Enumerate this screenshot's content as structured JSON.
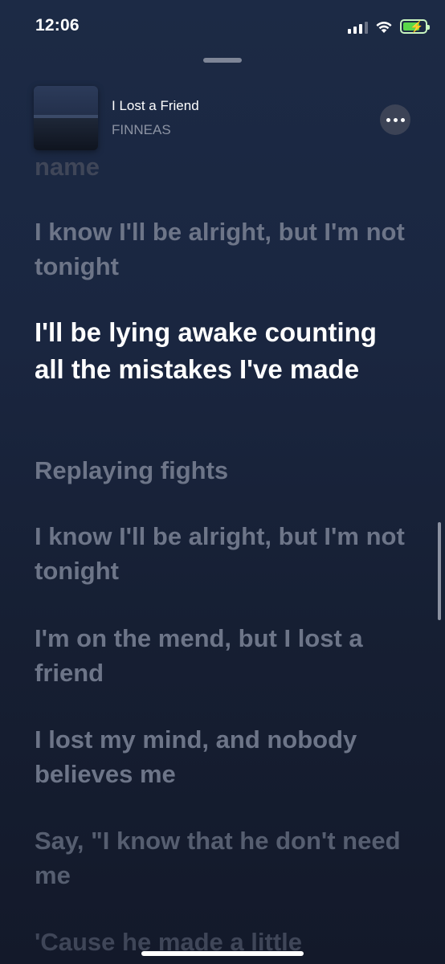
{
  "status_bar": {
    "time": "12:06",
    "signal_bars": 4,
    "signal_active": 3,
    "battery_percent": 65,
    "battery_charging": true
  },
  "now_playing": {
    "title": "I Lost a Friend",
    "artist": "FINNEAS",
    "artwork_icon": "album-art"
  },
  "lyrics": [
    {
      "text": "name",
      "state": "faded"
    },
    {
      "text": "I know I'll be alright, but I'm not tonight",
      "state": "inactive"
    },
    {
      "text": "I'll be lying awake counting all the mistakes I've made",
      "state": "active"
    },
    {
      "text": "Replaying fights",
      "state": "inactive"
    },
    {
      "text": "I know I'll be alright, but I'm not tonight",
      "state": "inactive"
    },
    {
      "text": "I'm on the mend, but I lost a friend",
      "state": "inactive"
    },
    {
      "text": "I lost my mind, and nobody believes me",
      "state": "inactive"
    },
    {
      "text": "Say, \"I know that he don't need me",
      "state": "inactive"
    },
    {
      "text": "'Cause he made a little",
      "state": "faded"
    }
  ],
  "colors": {
    "active_lyric": "#ffffff",
    "inactive_lyric": "#6d7588",
    "background": "#1a2640"
  }
}
